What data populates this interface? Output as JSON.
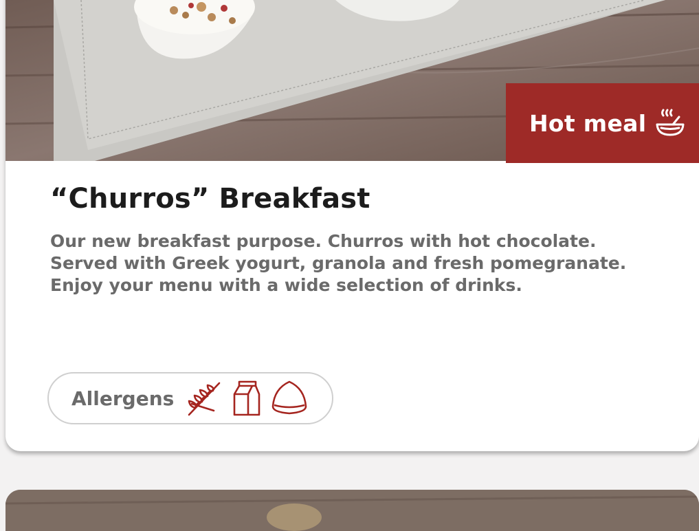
{
  "card": {
    "badge": {
      "label": "Hot meal",
      "icon": "hot-bowl-icon"
    },
    "title": "“Churros” Breakfast",
    "description": "Our new breakfast purpose. Churros with hot chocolate. Served with Greek yogurt, granola and fresh pomegranate. Enjoy your menu with a wide selection of drinks.",
    "allergens": {
      "label": "Allergens",
      "icons": [
        "gluten-wheat-icon",
        "milk-carton-icon",
        "nuts-icon"
      ]
    }
  },
  "colors": {
    "badge_background": "#9e2a27",
    "icon_color": "#a5251f",
    "title_color": "#1c1c1c",
    "text_color": "#6a6a6a"
  }
}
